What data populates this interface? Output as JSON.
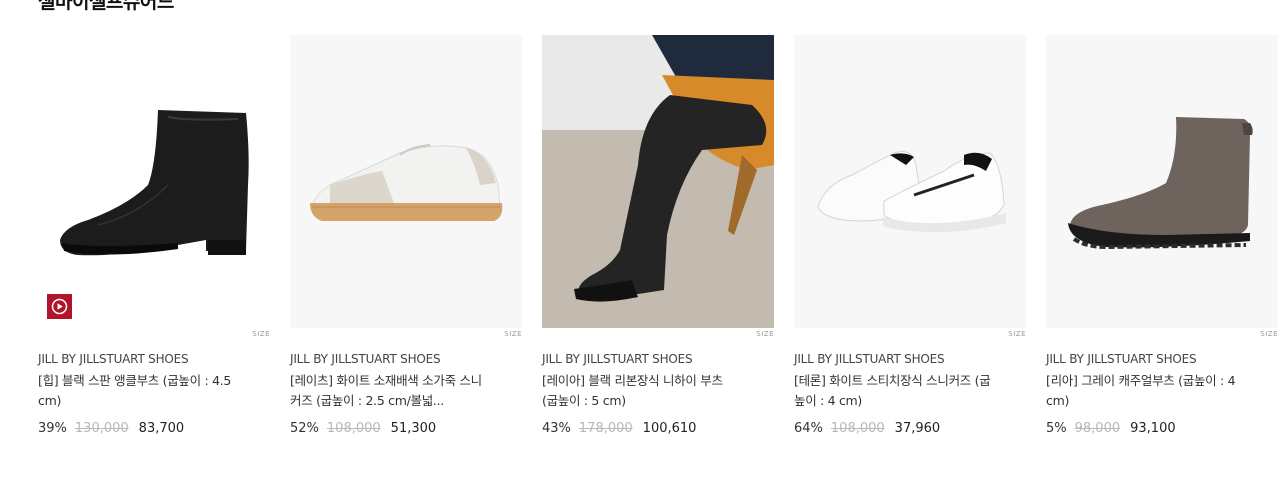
{
  "section": {
    "title": "셀마이셀프슈어드"
  },
  "products": [
    {
      "brand": "JILL BY JILLSTUART SHOES",
      "name": "[힙] 블랙 스판 앵클부츠 (굽높이 : 4.5 cm)",
      "discount": "39%",
      "original_price": "130,000",
      "sale_price": "83,700",
      "size_label": "SIZE",
      "has_video": true
    },
    {
      "brand": "JILL BY JILLSTUART SHOES",
      "name": "[레이츠] 화이트 소재배색 소가죽 스니커즈 (굽높이 : 2.5 cm/볼넓...",
      "discount": "52%",
      "original_price": "108,000",
      "sale_price": "51,300",
      "size_label": "SIZE",
      "has_video": false
    },
    {
      "brand": "JILL BY JILLSTUART SHOES",
      "name": "[레이아] 블랙 리본장식 니하이 부츠 (굽높이 : 5 cm)",
      "discount": "43%",
      "original_price": "178,000",
      "sale_price": "100,610",
      "size_label": "SIZE",
      "has_video": false
    },
    {
      "brand": "JILL BY JILLSTUART SHOES",
      "name": "[테론] 화이트 스티치장식 스니커즈 (굽높이 : 4 cm)",
      "discount": "64%",
      "original_price": "108,000",
      "sale_price": "37,960",
      "size_label": "SIZE",
      "has_video": false
    },
    {
      "brand": "JILL BY JILLSTUART SHOES",
      "name": "[리아] 그레이 캐주얼부츠 (굽높이 : 4 cm)",
      "discount": "5%",
      "original_price": "98,000",
      "sale_price": "93,100",
      "size_label": "SIZE",
      "has_video": false
    }
  ],
  "icons": {
    "video": "play-circle-icon"
  },
  "colors": {
    "video_badge": "#b0152a",
    "strike_price": "#b8b8b8"
  }
}
